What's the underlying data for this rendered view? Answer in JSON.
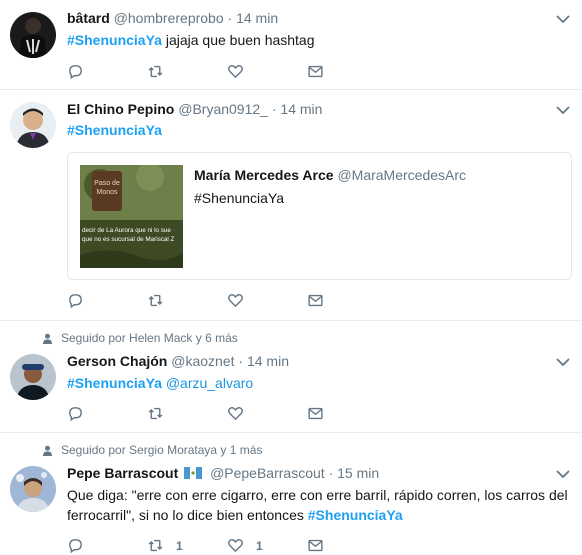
{
  "tweets": [
    {
      "fullname": "bâtard",
      "username": "@hombrereprobo",
      "sep": "·",
      "time": "14 min",
      "text_hashtag": "#ShenunciaYa",
      "text_rest": " jajaja que buen hashtag",
      "actions": {
        "reply": "",
        "retweet": "",
        "like": ""
      }
    },
    {
      "fullname": "El Chino Pepino",
      "username": "@Bryan0912_",
      "sep": "·",
      "time": "14 min",
      "text_hashtag": "#ShenunciaYa",
      "quote": {
        "fullname": "María Mercedes Arce",
        "username": "@MaraMercedesArc",
        "text": "#ShenunciaYa",
        "media_caption_1": "decir de La Aurora que ni lo sue",
        "media_caption_2": "que no es sucursal de Mariscal Z",
        "media_sign_1": "Paso de",
        "media_sign_2": "Monos"
      }
    },
    {
      "social_context": "Seguido por Helen Mack y 6 más",
      "fullname": "Gerson Chajón",
      "username": "@kaoznet",
      "sep": "·",
      "time": "14 min",
      "text_hashtag": "#ShenunciaYa",
      "text_mention": "@arzu_alvaro"
    },
    {
      "social_context": "Seguido por Sergio Morataya y 1 más",
      "fullname": "Pepe Barrascout",
      "username": "@PepeBarrascout",
      "sep": "·",
      "time": "15 min",
      "text_line1": "Que diga: \"erre con erre cigarro, erre con erre barril, rápido corren, los carros del",
      "text_line2": "ferrocarril\", si no lo dice bien entonces ",
      "text_hashtag": "#ShenunciaYa",
      "actions": {
        "retweet_count": "1",
        "like_count": "1"
      }
    }
  ],
  "colors": {
    "link": "#1da1f2",
    "secondary": "#657786",
    "border": "#e6ecf0"
  }
}
